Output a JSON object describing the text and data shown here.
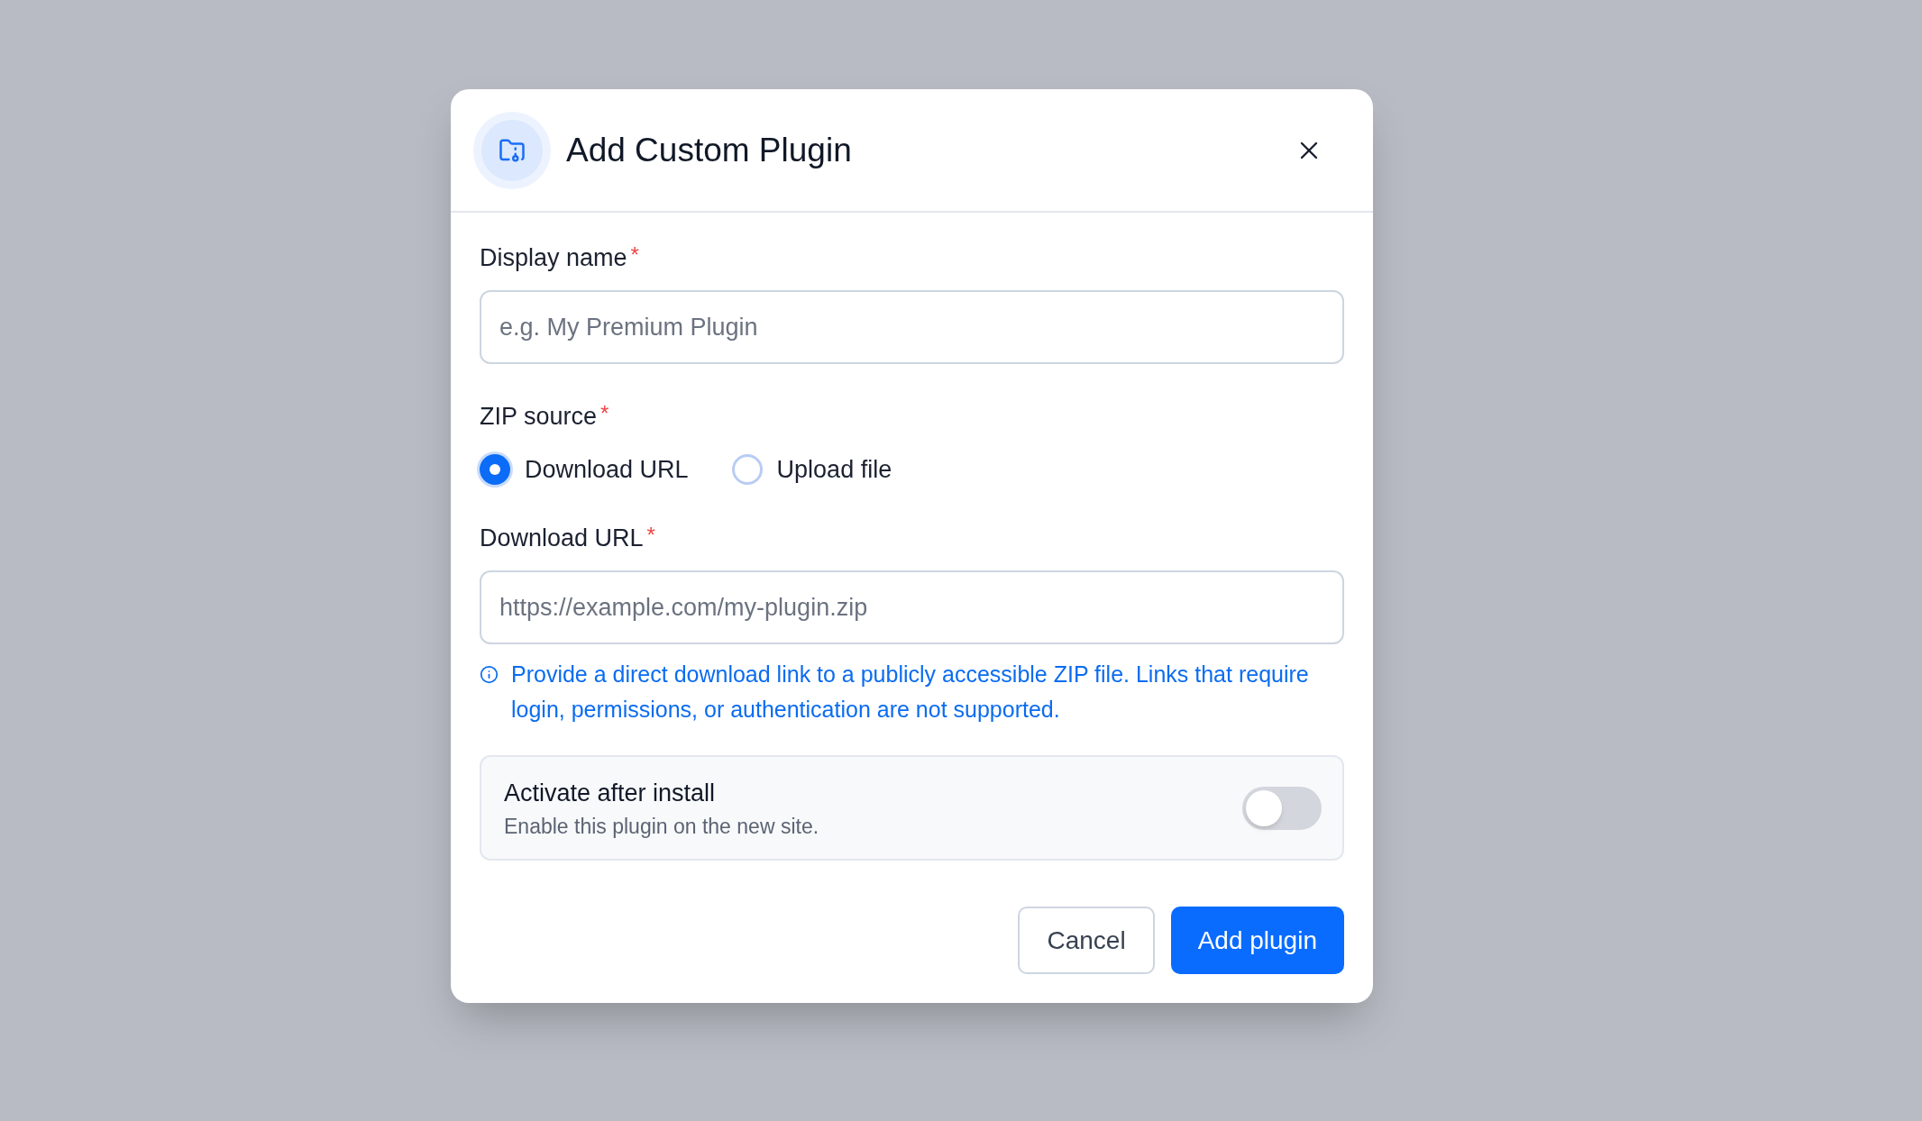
{
  "dialog": {
    "title": "Add Custom Plugin",
    "fields": [
      {
        "kind": "text",
        "label": "Display name",
        "required_mark": "*",
        "placeholder": "e.g. My Premium Plugin"
      },
      {
        "kind": "radio",
        "label": "ZIP source",
        "required_mark": "*",
        "options": [
          {
            "label": "Download URL",
            "selected": true
          },
          {
            "label": "Upload file",
            "selected": false
          }
        ]
      },
      {
        "kind": "text",
        "label": "Download URL",
        "required_mark": "*",
        "placeholder": "https://example.com/my-plugin.zip",
        "help": "Provide a direct download link to a publicly accessible ZIP file. Links that require login, permissions, or authentication are not supported."
      }
    ],
    "setting": {
      "title": "Activate after install",
      "description": "Enable this plugin on the new site.",
      "on": false
    },
    "buttons": [
      {
        "kind": "secondary",
        "label": "Cancel"
      },
      {
        "kind": "primary",
        "label": "Add plugin"
      }
    ]
  }
}
